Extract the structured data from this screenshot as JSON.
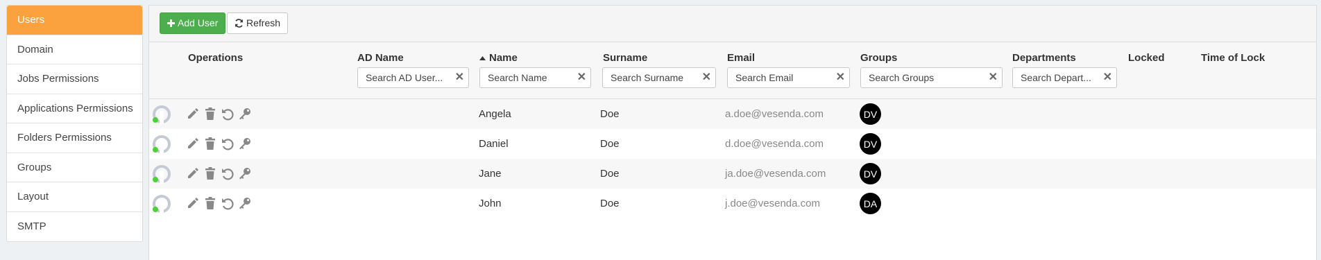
{
  "sidebar": {
    "items": [
      {
        "label": "Users",
        "active": true
      },
      {
        "label": "Domain"
      },
      {
        "label": "Jobs Permissions"
      },
      {
        "label": "Applications Permissions"
      },
      {
        "label": "Folders Permissions"
      },
      {
        "label": "Groups"
      },
      {
        "label": "Layout"
      },
      {
        "label": "SMTP"
      }
    ]
  },
  "toolbar": {
    "add_label": "Add User",
    "refresh_label": "Refresh"
  },
  "columns": {
    "operations": "Operations",
    "ad_name": "AD Name",
    "name": "Name",
    "surname": "Surname",
    "email": "Email",
    "groups": "Groups",
    "departments": "Departments",
    "locked": "Locked",
    "time_of_lock": "Time of Lock"
  },
  "filters": {
    "ad_name": "Search AD User...",
    "name": "Search Name",
    "surname": "Search Surname",
    "email": "Search Email",
    "groups": "Search Groups",
    "departments": "Search Depart..."
  },
  "rows": [
    {
      "name": "Angela",
      "surname": "Doe",
      "email": "a.doe@vesenda.com",
      "group": "DV"
    },
    {
      "name": "Daniel",
      "surname": "Doe",
      "email": "d.doe@vesenda.com",
      "group": "DV"
    },
    {
      "name": "Jane",
      "surname": "Doe",
      "email": "ja.doe@vesenda.com",
      "group": "DV"
    },
    {
      "name": "John",
      "surname": "Doe",
      "email": "j.doe@vesenda.com",
      "group": "DA"
    }
  ],
  "colors": {
    "accent": "#fba23e",
    "add_button": "#4cae4c",
    "online_dot": "#4cd137",
    "icon_gray": "#888888"
  },
  "icons": {
    "add": "plus-icon",
    "refresh": "refresh-icon",
    "sort": "sort-asc-icon",
    "edit": "pencil-icon",
    "delete": "trash-icon",
    "reset": "undo-icon",
    "password": "key-icon",
    "avatar": "user-avatar-icon"
  }
}
